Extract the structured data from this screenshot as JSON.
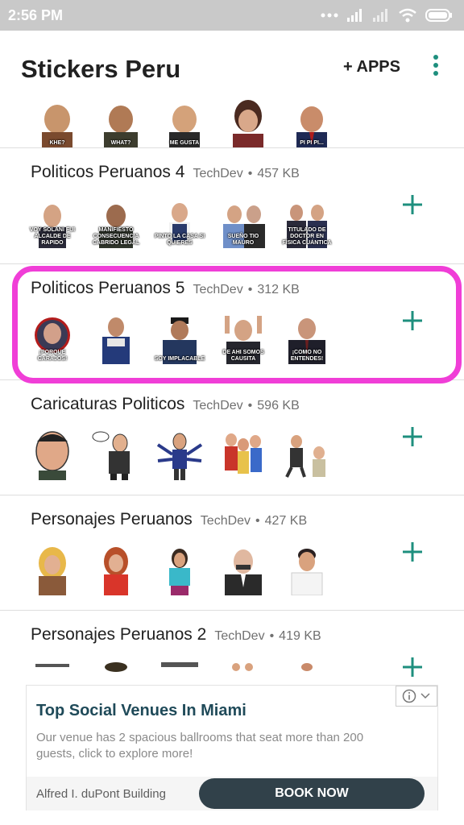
{
  "status_bar": {
    "time": "2:56 PM",
    "battery": "battery-icon",
    "wifi": "wifi-icon",
    "signal": "cell-signal-icon"
  },
  "app_bar": {
    "title": "Stickers Peru",
    "apps_label": "+ APPS",
    "menu_icon": "more-vert-icon"
  },
  "partial_pack_top": {
    "captions": [
      "KHE?",
      "WHAT?",
      "ME GUSTA",
      "",
      "PI PI PI..."
    ]
  },
  "packs": [
    {
      "title": "Politicos Peruanos 4",
      "author": "TechDev",
      "size": "457 KB",
      "captions": [
        "VOY SOLANI FUI ALCALDE DE RAPIDO",
        "MANIFIESTO CONSECUENCIA CABRIDO LEGAL",
        "PINTO LA CASA SI QUIERES",
        "SUEÑO TIO MAURO",
        "TITULADO DE DOCTOR EN FÍSICA CUÁNTICA"
      ]
    },
    {
      "title": "Politicos Peruanos 5",
      "author": "TechDev",
      "size": "312 KB",
      "captions": [
        "¡Porque carajos!",
        "",
        "SOY IMPLACABLE",
        "DE AHI SOMOS CAUSITA",
        "¡COMO NO ENTENDES!"
      ]
    },
    {
      "title": "Caricaturas Politicos",
      "author": "TechDev",
      "size": "596 KB",
      "captions": [
        "",
        "",
        "",
        "",
        ""
      ]
    },
    {
      "title": "Personajes Peruanos",
      "author": "TechDev",
      "size": "427 KB",
      "captions": [
        "",
        "",
        "",
        "",
        ""
      ]
    },
    {
      "title": "Personajes Peruanos 2",
      "author": "TechDev",
      "size": "419 KB",
      "captions": [
        "",
        "",
        "",
        "",
        ""
      ]
    }
  ],
  "ad": {
    "title": "Top Social Venues In Miami",
    "body": "Our venue has 2 spacious ballrooms that seat more than 200 guests, click to explore more!",
    "advertiser": "Alfred I. duPont Building",
    "cta": "BOOK NOW",
    "choices_icon": "info-icon"
  },
  "colors": {
    "accent": "#1e8f7e",
    "highlight": "#f03ed7",
    "ad_button": "#31414a",
    "status_bar": "#c9c9c9"
  }
}
